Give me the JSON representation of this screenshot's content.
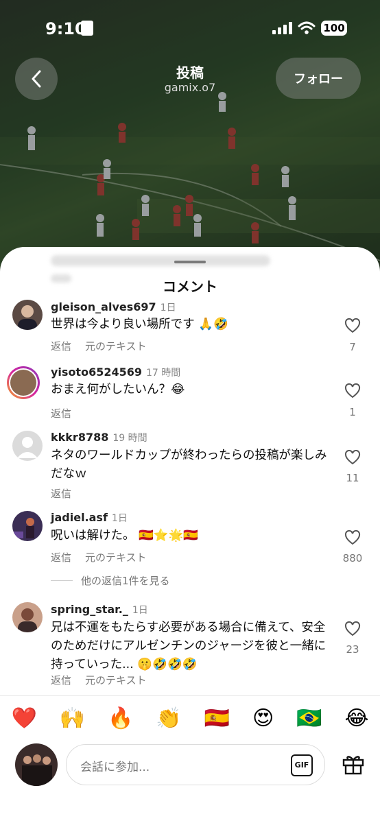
{
  "status": {
    "time": "9:10",
    "battery": "100"
  },
  "header": {
    "title": "投稿",
    "subtitle": "gamix.o7",
    "follow_label": "フォロー"
  },
  "sheet": {
    "title": "コメント"
  },
  "comments": [
    {
      "username": "gleison_alves697",
      "time": "1日",
      "text": "世界は今より良い場所です 🙏🤣",
      "reply": "返信",
      "translate": "元のテキスト",
      "likes": "7"
    },
    {
      "username": "yisoto6524569",
      "time": "17 時間",
      "text": "おまえ何がしたいん？😂",
      "reply": "返信",
      "likes": "1"
    },
    {
      "username": "kkkr8788",
      "time": "19 時間",
      "text": "ネタのワールドカップが終わったらの投稿が楽しみだなｗ",
      "reply": "返信",
      "likes": "11"
    },
    {
      "username": "jadiel.asf",
      "time": "1日",
      "text": "呪いは解けた。 🇪🇸⭐🌟🇪🇸",
      "reply": "返信",
      "translate": "元のテキスト",
      "likes": "880",
      "more_replies": "他の返信1件を見る"
    },
    {
      "username": "spring_star._",
      "time": "1日",
      "text": "兄は不運をもたらす必要がある場合に備えて、安全のためだけにアルゼンチンのジャージを彼と一緒に持っていった... 🤫🤣🤣🤣",
      "reply": "返信",
      "translate": "元のテキスト",
      "likes": "23"
    }
  ],
  "emoji_bar": [
    "❤️",
    "🙌",
    "🔥",
    "👏",
    "🇪🇸",
    "😍",
    "🇧🇷",
    "😂"
  ],
  "input": {
    "placeholder": "会話に参加...",
    "gif_label": "GIF"
  }
}
